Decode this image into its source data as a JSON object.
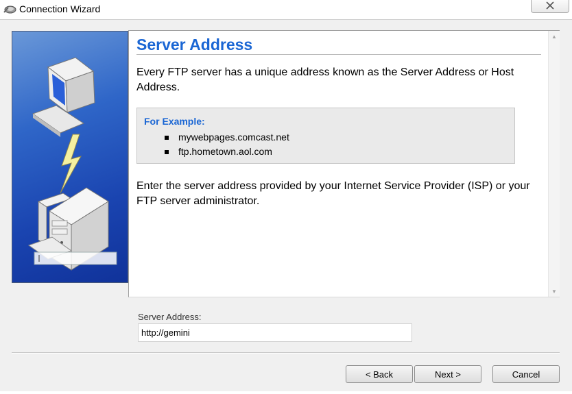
{
  "window": {
    "title": "Connection Wizard",
    "app_icon": "network-wizard-icon",
    "close_icon": "close-icon"
  },
  "page": {
    "heading": "Server Address",
    "intro": "Every FTP server has a unique address known as the Server Address or Host Address.",
    "example": {
      "label": "For Example:",
      "items": [
        "mywebpages.comcast.net",
        "ftp.hometown.aol.com"
      ]
    },
    "instructions": "Enter the server address provided by your Internet Service Provider (ISP) or your FTP server administrator."
  },
  "server_address": {
    "label": "Server Address:",
    "value": "http://gemini"
  },
  "buttons": {
    "back": "< Back",
    "next": "Next >",
    "cancel": "Cancel"
  },
  "colors": {
    "heading": "#1a66d4",
    "panel_blue": "#1a44b0"
  }
}
